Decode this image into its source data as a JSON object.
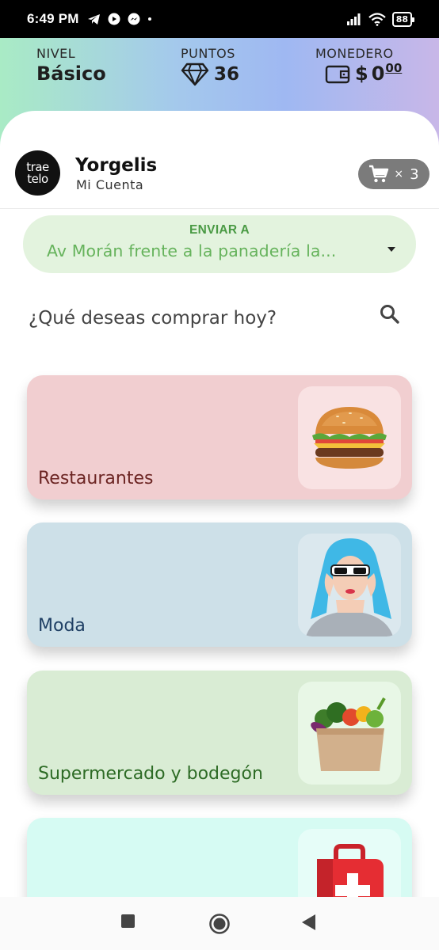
{
  "status_bar": {
    "time": "6:49 PM",
    "battery": "88"
  },
  "stats": {
    "level": {
      "label": "NIVEL",
      "value": "Básico"
    },
    "points": {
      "label": "PUNTOS",
      "value": "36"
    },
    "wallet": {
      "label": "MONEDERO",
      "currency": "$",
      "whole": "0",
      "cents": "00"
    }
  },
  "user": {
    "logo_top": "trae",
    "logo_bottom": "telo",
    "name": "Yorgelis",
    "subtitle": "Mi Cuenta"
  },
  "cart": {
    "times": "×",
    "count": "3"
  },
  "address": {
    "label": "ENVIAR A",
    "value": "Av Morán frente a la panadería la..."
  },
  "search": {
    "placeholder": "¿Qué deseas comprar hoy?"
  },
  "categories": [
    {
      "label": "Restaurantes",
      "icon": "burger-image"
    },
    {
      "label": "Moda",
      "icon": "fashion-model-image"
    },
    {
      "label": "Supermercado y bodegón",
      "icon": "grocery-bag-image"
    },
    {
      "label": "",
      "icon": "first-aid-kit-image"
    }
  ],
  "colors": {
    "accent_green": "#4a9a44",
    "restaurant": "#f1ced0",
    "moda": "#cde0e8",
    "super": "#d9ecd4",
    "farmacia": "#d6fbf3"
  }
}
